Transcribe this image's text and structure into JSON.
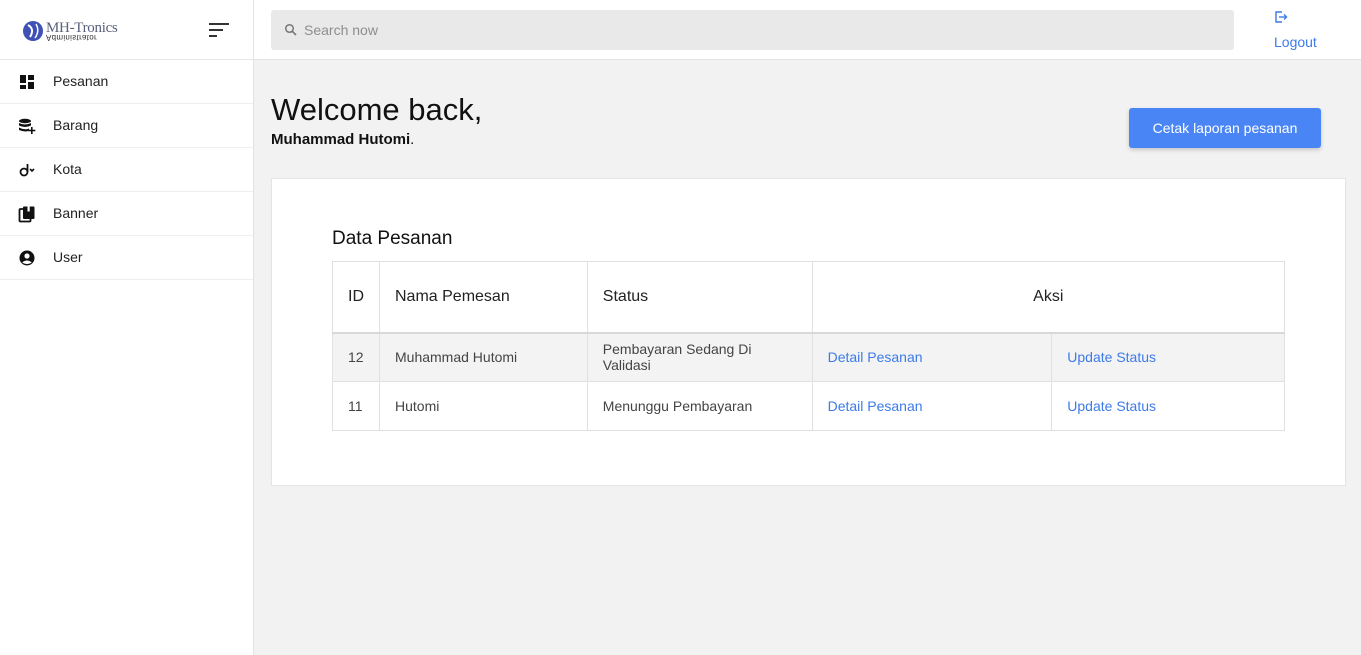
{
  "brand": {
    "logo_text": "MH-Tronics",
    "logo_subtitle": "Administrator"
  },
  "sidebar": {
    "items": [
      {
        "label": "Pesanan",
        "icon": "dashboard-icon"
      },
      {
        "label": "Barang",
        "icon": "database-add-icon"
      },
      {
        "label": "Kota",
        "icon": "location-pin-icon"
      },
      {
        "label": "Banner",
        "icon": "book-icon"
      },
      {
        "label": "User",
        "icon": "account-circle-icon"
      }
    ]
  },
  "header": {
    "search_placeholder": "Search now",
    "logout_label": "Logout"
  },
  "main": {
    "welcome": "Welcome back,",
    "user_name": "Muhammad Hutomi",
    "user_name_suffix": ".",
    "print_button": "Cetak laporan pesanan"
  },
  "orders": {
    "title": "Data Pesanan",
    "columns": [
      "ID",
      "Nama Pemesan",
      "Status",
      "Aksi"
    ],
    "rows": [
      {
        "id": "12",
        "name": "Muhammad Hutomi",
        "status": "Pembayaran Sedang Di Validasi",
        "detail": "Detail Pesanan",
        "update": "Update Status"
      },
      {
        "id": "11",
        "name": "Hutomi",
        "status": "Menunggu Pembayaran",
        "detail": "Detail Pesanan",
        "update": "Update Status"
      }
    ]
  },
  "colors": {
    "accent": "#4a85f5",
    "link": "#3d7be8",
    "background": "#f2f2f2"
  }
}
